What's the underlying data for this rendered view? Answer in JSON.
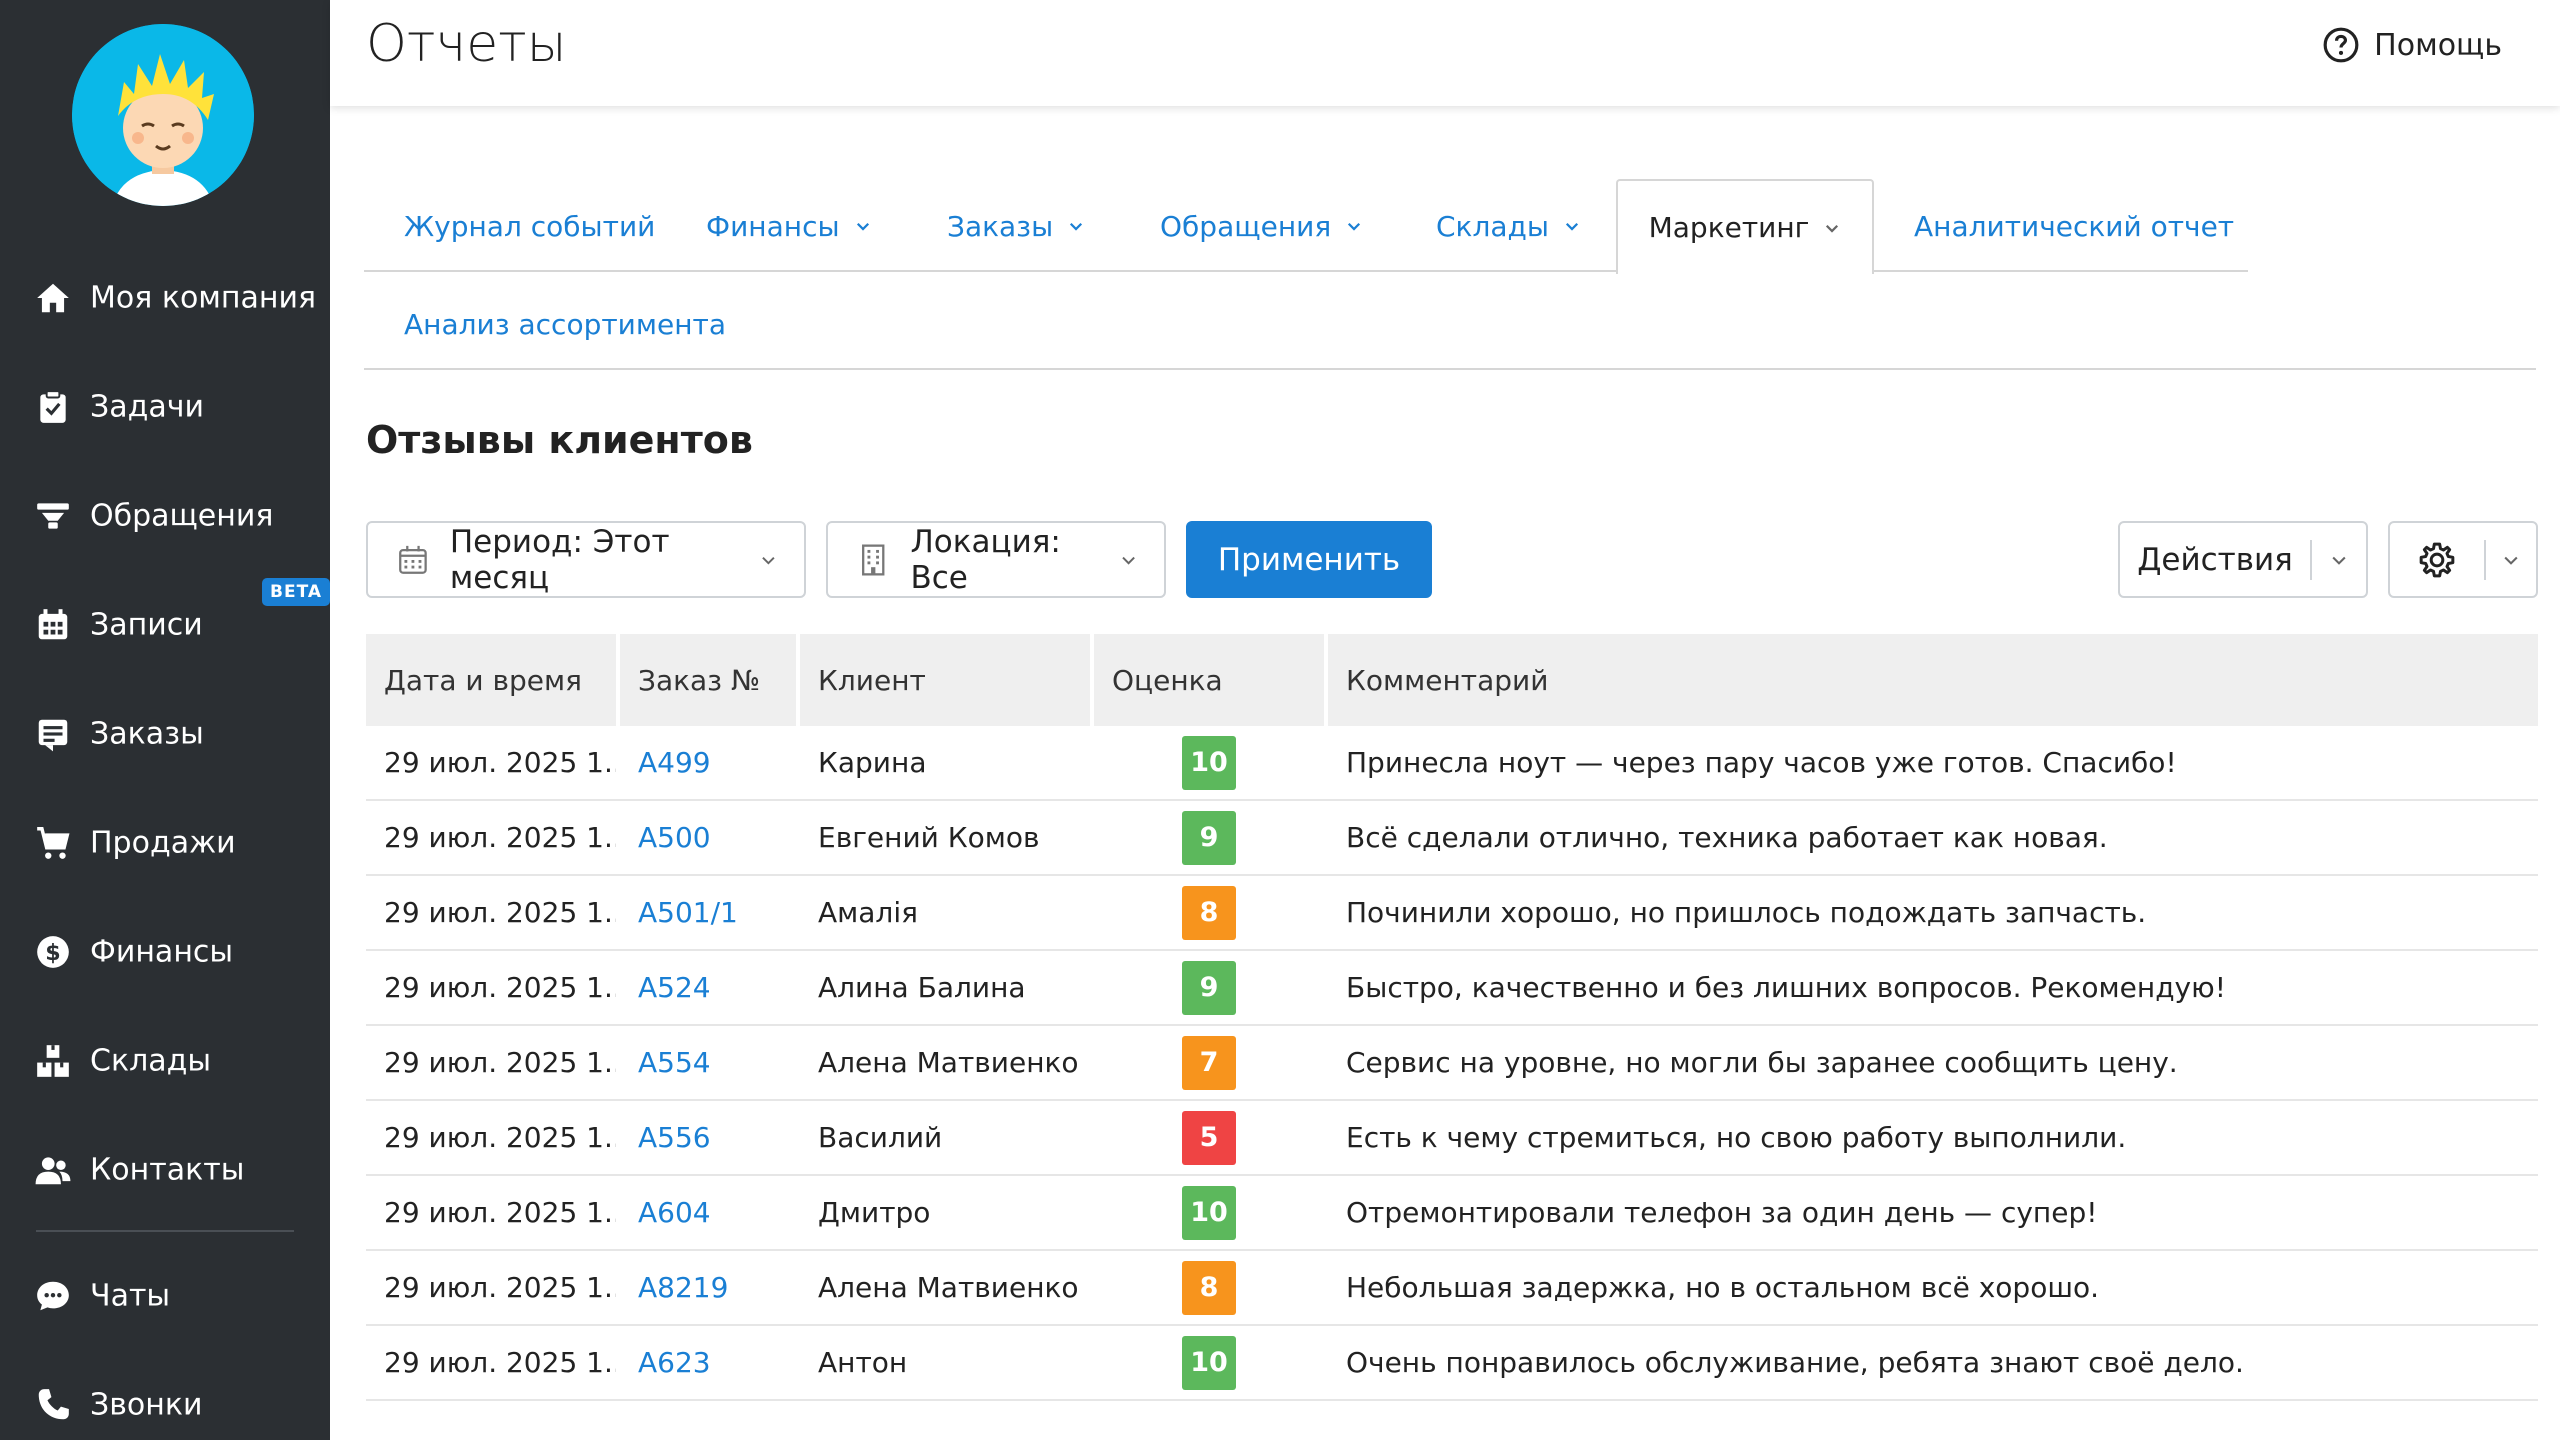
{
  "colors": {
    "sidebar_bg": "#2b2f33",
    "accent": "#1a7fd4",
    "score_green": "#5cb85c",
    "score_orange": "#f7941d",
    "score_red": "#ef4444"
  },
  "header": {
    "title": "Отчеты",
    "help_label": "Помощь",
    "help_icon": "question-circle-icon"
  },
  "sidebar": {
    "items": [
      {
        "label": "Моя компания",
        "icon": "home-icon"
      },
      {
        "label": "Задачи",
        "icon": "clipboard-icon"
      },
      {
        "label": "Обращения",
        "icon": "funnel-icon"
      },
      {
        "label": "Записи",
        "icon": "calendar-icon",
        "badge": "BETA"
      },
      {
        "label": "Заказы",
        "icon": "orders-icon"
      },
      {
        "label": "Продажи",
        "icon": "cart-icon"
      },
      {
        "label": "Финансы",
        "icon": "dollar-icon"
      },
      {
        "label": "Склады",
        "icon": "boxes-icon"
      },
      {
        "label": "Контакты",
        "icon": "contacts-icon"
      },
      {
        "label": "Чаты",
        "icon": "chat-icon"
      },
      {
        "label": "Звонки",
        "icon": "phone-icon"
      }
    ]
  },
  "tabs": [
    {
      "label": "Журнал событий",
      "dropdown": false
    },
    {
      "label": "Финансы",
      "dropdown": true
    },
    {
      "label": "Заказы",
      "dropdown": true
    },
    {
      "label": "Обращения",
      "dropdown": true
    },
    {
      "label": "Склады",
      "dropdown": true
    },
    {
      "label": "Маркетинг",
      "dropdown": true,
      "active": true
    },
    {
      "label": "Аналитический отчет",
      "dropdown": false
    },
    {
      "label": "Анализ ассортимента",
      "dropdown": false
    }
  ],
  "section": {
    "title": "Отзывы клиентов"
  },
  "filters": {
    "period_label": "Период: Этот месяц",
    "location_label": "Локация: Все",
    "apply_label": "Применить",
    "actions_label": "Действия"
  },
  "table": {
    "columns": [
      "Дата и время",
      "Заказ №",
      "Клиент",
      "Оценка",
      "Комментарий"
    ],
    "rows": [
      {
        "date": "29 июл. 2025 1...",
        "order": "A499",
        "client": "Карина",
        "score": "10",
        "level": "green",
        "comment": "Принесла ноут — через пару часов уже готов. Спасибо!"
      },
      {
        "date": "29 июл. 2025 1...",
        "order": "A500",
        "client": "Евгений Комов",
        "score": "9",
        "level": "green",
        "comment": "Всё сделали отлично, техника работает как новая."
      },
      {
        "date": "29 июл. 2025 1...",
        "order": "A501/1",
        "client": "Амалія",
        "score": "8",
        "level": "orange",
        "comment": "Починили хорошо, но пришлось подождать запчасть."
      },
      {
        "date": "29 июл. 2025 1...",
        "order": "A524",
        "client": "Алина Балина",
        "score": "9",
        "level": "green",
        "comment": "Быстро, качественно и без лишних вопросов. Рекомендую!"
      },
      {
        "date": "29 июл. 2025 1...",
        "order": "A554",
        "client": "Алена Матвиенко",
        "score": "7",
        "level": "orange",
        "comment": "Сервис на уровне, но могли бы заранее сообщить цену."
      },
      {
        "date": "29 июл. 2025 1...",
        "order": "A556",
        "client": "Василий",
        "score": "5",
        "level": "red",
        "comment": "Есть к чему стремиться, но свою работу выполнили."
      },
      {
        "date": "29 июл. 2025 1...",
        "order": "A604",
        "client": "Дмитро",
        "score": "10",
        "level": "green",
        "comment": "Отремонтировали телефон за один день — супер!"
      },
      {
        "date": "29 июл. 2025 1...",
        "order": "A8219",
        "client": "Алена Матвиенко",
        "score": "8",
        "level": "orange",
        "comment": "Небольшая задержка, но в остальном всё хорошо."
      },
      {
        "date": "29 июл. 2025 1...",
        "order": "A623",
        "client": "Антон",
        "score": "10",
        "level": "green",
        "comment": "Очень понравилось обслуживание, ребята знают своё дело."
      }
    ]
  }
}
